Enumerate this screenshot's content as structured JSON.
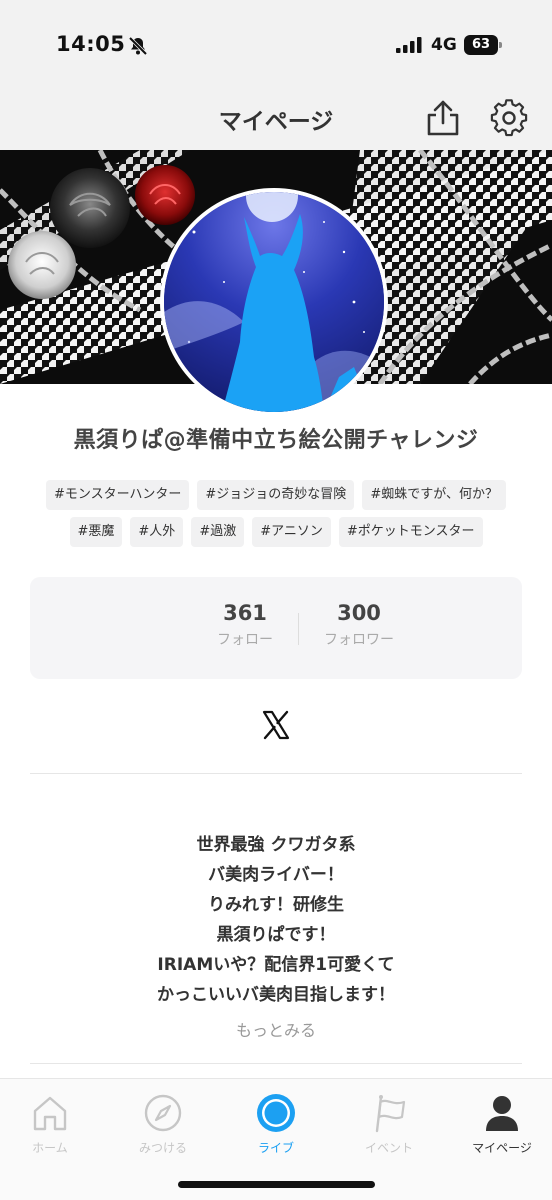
{
  "status_bar": {
    "time": "14:05",
    "network": "4G",
    "battery": "63",
    "icons": [
      "bell-off-icon",
      "signal-icon",
      "battery-icon"
    ]
  },
  "header": {
    "title": "マイページ",
    "icons": [
      "share-icon",
      "gear-icon"
    ]
  },
  "profile": {
    "display_name": "黒須りぱ@準備中立ち絵公開チャレンジ",
    "tags_row1": [
      "#モンスターハンター",
      "#ジョジョの奇妙な冒険",
      "#蜘蛛ですが、何か？"
    ],
    "tags_row2": [
      "#悪魔",
      "#人外",
      "#過激",
      "#アニソン",
      "#ポケットモンスター"
    ]
  },
  "stats": {
    "follow_count": "361",
    "follow_label": "フォロー",
    "follower_count": "300",
    "follower_label": "フォロワー"
  },
  "social": {
    "icon": "x-logo-icon"
  },
  "bio": {
    "lines": [
      "世界最強 クワガタ系",
      "バ美肉ライバー！",
      "りみれす！研修生",
      "黒須りぱです！",
      "IRIAMいや？配信界1可愛くて",
      "かっこいいバ美肉目指します！"
    ],
    "see_more": "もっとみる"
  },
  "tab_bar": {
    "tabs": [
      {
        "label": "ホーム",
        "icon": "home-icon"
      },
      {
        "label": "みつける",
        "icon": "compass-icon"
      },
      {
        "label": "ライブ",
        "icon": "live-icon"
      },
      {
        "label": "イベント",
        "icon": "flag-icon"
      },
      {
        "label": "マイページ",
        "icon": "person-icon"
      }
    ]
  },
  "colors": {
    "accent": "#1ca0f2",
    "inactive": "#c6c6c6",
    "header_bg": "#f2f2f2"
  }
}
